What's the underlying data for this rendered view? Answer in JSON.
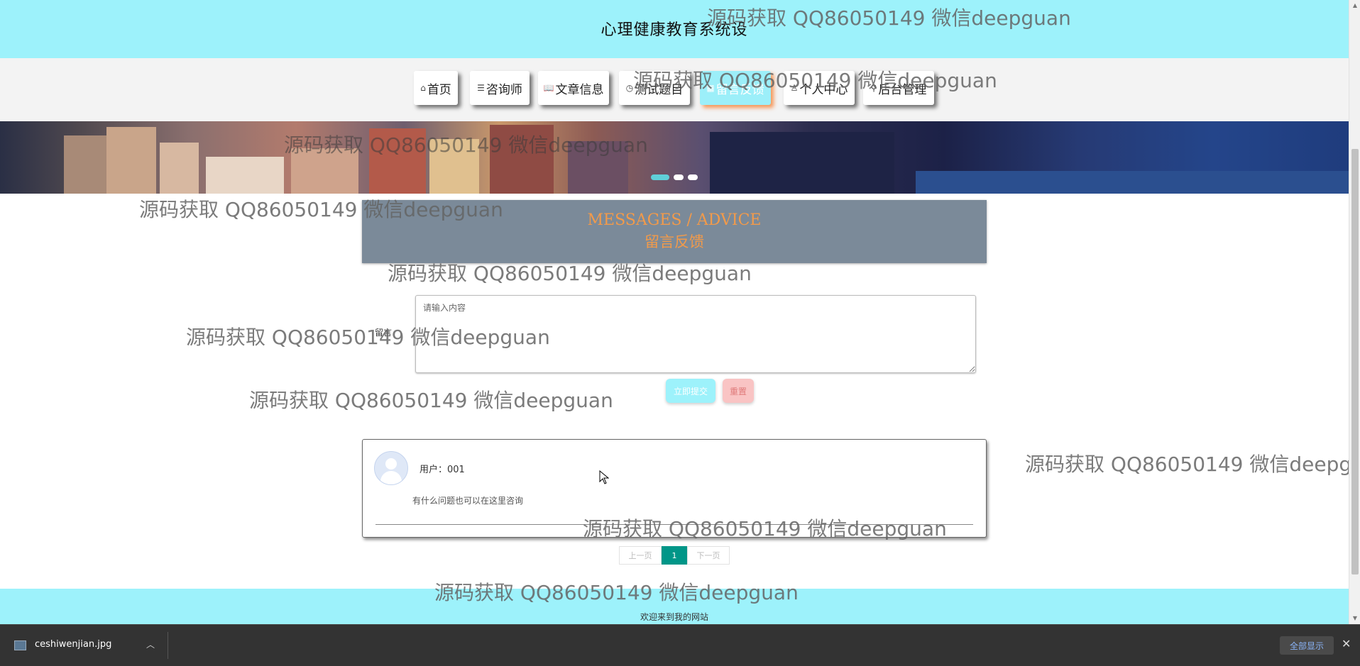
{
  "header": {
    "title": "心理健康教育系统设"
  },
  "nav": {
    "items": [
      {
        "icon": "⌂",
        "label": "首页"
      },
      {
        "icon": "☰",
        "label": "咨询师"
      },
      {
        "icon": "📖",
        "label": "文章信息"
      },
      {
        "icon": "◷",
        "label": "测试题目"
      },
      {
        "icon": "▦",
        "label": "留言反馈",
        "active": true
      },
      {
        "icon": "♙",
        "label": "个人中心"
      },
      {
        "icon": "⚲",
        "label": "后台管理"
      }
    ]
  },
  "banner": {
    "slides": 3,
    "active_slide": 1
  },
  "section": {
    "title_en": "MESSAGES / ADVICE",
    "title_cn": "留言反馈"
  },
  "form": {
    "label": "留言",
    "placeholder": "请输入内容",
    "submit_label": "立即提交",
    "reset_label": "重置"
  },
  "messages": [
    {
      "user": "用户：001",
      "content": "有什么问题也可以在这里咨询"
    }
  ],
  "pagination": {
    "prev": "上一页",
    "current": "1",
    "next": "下一页"
  },
  "footer": {
    "text": "欢迎来到我的网站"
  },
  "watermark": {
    "text": "源码获取 QQ86050149 微信deepguan"
  },
  "downloads": {
    "file_name": "ceshiwenjian.jpg",
    "show_all": "全部显示"
  },
  "colors": {
    "header_bg": "#9df2fb",
    "active_nav": "#9ceff9",
    "accent_orange": "#f29a4a",
    "page_active": "#009688"
  }
}
